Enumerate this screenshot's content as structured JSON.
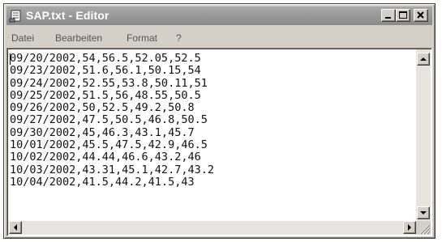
{
  "window": {
    "title": "SAP.txt - Editor",
    "icon": "notepad-icon"
  },
  "menu": {
    "items": [
      "Datei",
      "Bearbeiten",
      "Format",
      "?"
    ]
  },
  "editor": {
    "lines": [
      "09/20/2002,54,56.5,52.05,52.5",
      "09/23/2002,51.6,56.1,50.15,54",
      "09/24/2002,52.55,53.8,50.11,51",
      "09/25/2002,51.5,56,48.55,50.5",
      "09/26/2002,50,52.5,49.2,50.8",
      "09/27/2002,47.5,50.5,46.8,50.5",
      "09/30/2002,45,46.3,43.1,45.7",
      "10/01/2002,45.5,47.5,42.9,46.5",
      "10/02/2002,44.44,46.6,43.2,46",
      "10/03/2002,43.31,45.1,42.7,43.2",
      "10/04/2002,41.5,44.2,41.5,43"
    ]
  }
}
